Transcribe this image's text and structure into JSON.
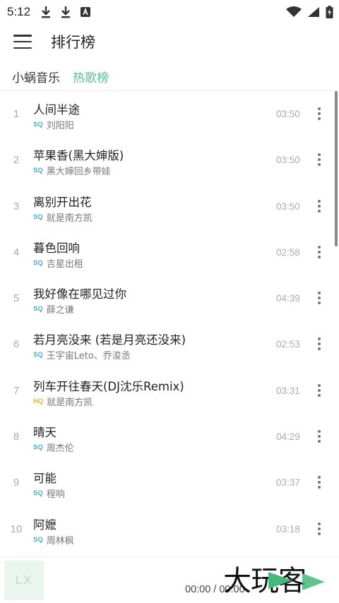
{
  "status_bar": {
    "time": "5:12",
    "left_icons": [
      "download-icon",
      "download-icon",
      "app-notification-icon"
    ],
    "right_icons": [
      "wifi-icon",
      "signal-icon",
      "battery-charging-icon"
    ]
  },
  "app_bar": {
    "title": "排行榜",
    "menu_icon": "menu-icon"
  },
  "tabs": {
    "source": "小蜗音乐",
    "board": "热歌榜",
    "active_color": "#5cbf8d"
  },
  "songs": [
    {
      "index": "1",
      "title": "人间半途",
      "quality": "SQ",
      "artist": "刘阳阳",
      "duration": "03:50"
    },
    {
      "index": "2",
      "title": "苹果香(黑大婶版)",
      "quality": "SQ",
      "artist": "黑大婶回乡带娃",
      "duration": "03:50"
    },
    {
      "index": "3",
      "title": "离别开出花",
      "quality": "SQ",
      "artist": "就是南方凯",
      "duration": "03:50"
    },
    {
      "index": "4",
      "title": "暮色回响",
      "quality": "SQ",
      "artist": "吉星出租",
      "duration": "02:58"
    },
    {
      "index": "5",
      "title": "我好像在哪见过你",
      "quality": "SQ",
      "artist": "薛之谦",
      "duration": "04:39"
    },
    {
      "index": "6",
      "title": "若月亮没来 (若是月亮还没来)",
      "quality": "SQ",
      "artist": "王宇宙Leto、乔浚丞",
      "duration": "02:53"
    },
    {
      "index": "7",
      "title": "列车开往春天(DJ沈乐Remix)",
      "quality": "HQ",
      "artist": "就是南方凯",
      "duration": "03:31"
    },
    {
      "index": "8",
      "title": "晴天",
      "quality": "SQ",
      "artist": "周杰伦",
      "duration": "04:29"
    },
    {
      "index": "9",
      "title": "可能",
      "quality": "SQ",
      "artist": "程响",
      "duration": "03:37"
    },
    {
      "index": "10",
      "title": "阿嬷",
      "quality": "SQ",
      "artist": "周林枫",
      "duration": "03:18"
    }
  ],
  "player": {
    "cover_text": "LX",
    "time": "00:00 / 00:00"
  },
  "watermark": {
    "text": "大玩客"
  }
}
